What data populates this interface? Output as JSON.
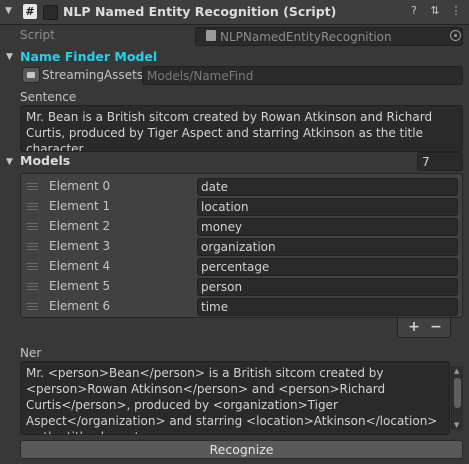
{
  "header": {
    "title": "NLP Named Entity Recognition (Script)",
    "icons": [
      "help-icon",
      "preset-icon",
      "more-icon"
    ]
  },
  "script_field": {
    "label": "Script",
    "value": "NLPNamedEntityRecognition"
  },
  "name_finder_model": {
    "title": "Name Finder Model",
    "title_color": "#1fd4ea",
    "prefix": "StreamingAssets/",
    "placeholder": "Models/NameFind"
  },
  "sentence": {
    "label": "Sentence",
    "text": "Mr. Bean is a British sitcom created by Rowan Atkinson and Richard Curtis, produced by Tiger Aspect and starring Atkinson as the title character."
  },
  "models": {
    "title": "Models",
    "count": "7",
    "items": [
      {
        "label": "Element 0",
        "value": "date"
      },
      {
        "label": "Element 1",
        "value": "location"
      },
      {
        "label": "Element 2",
        "value": "money"
      },
      {
        "label": "Element 3",
        "value": "organization"
      },
      {
        "label": "Element 4",
        "value": "percentage"
      },
      {
        "label": "Element 5",
        "value": "person"
      },
      {
        "label": "Element 6",
        "value": "time"
      }
    ],
    "add_label": "+",
    "remove_label": "−"
  },
  "ner": {
    "label": "Ner",
    "text": "Mr. <person>Bean</person> is a British sitcom created by <person>Rowan Atkinson</person> and <person>Richard Curtis</person>, produced by <organization>Tiger Aspect</organization> and starring <location>Atkinson</location> as the title character."
  },
  "recognize_button": {
    "label": "Recognize"
  }
}
